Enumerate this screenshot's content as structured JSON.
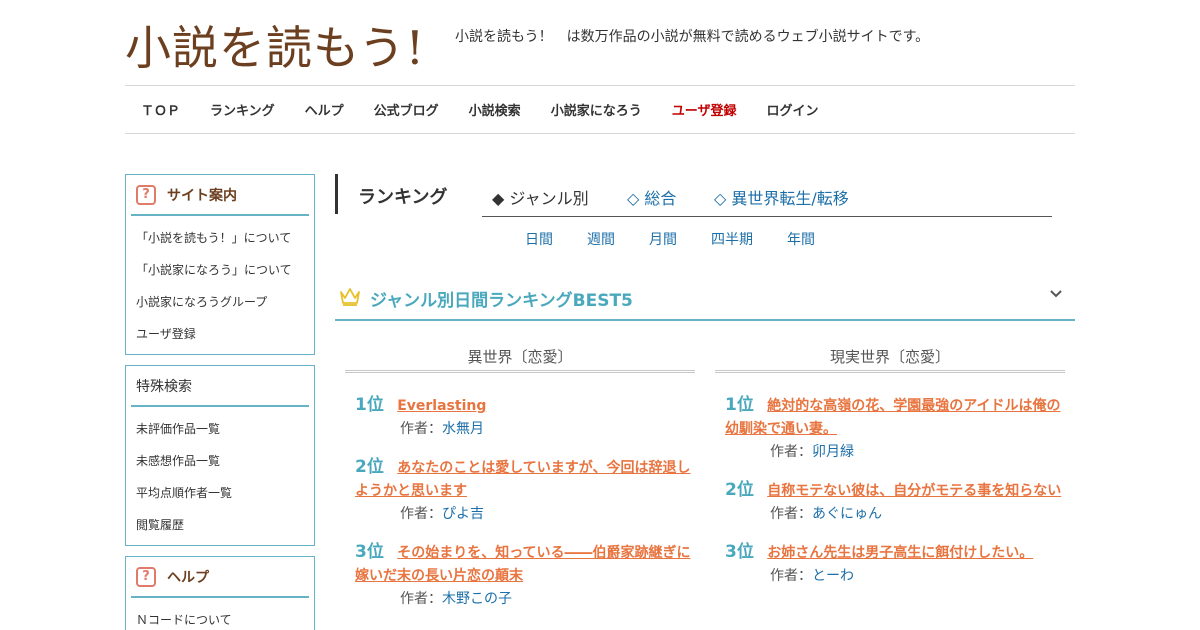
{
  "header": {
    "logo": "小説を読もう!",
    "tagline": "小説を読もう！　は数万作品の小説が無料で読めるウェブ小説サイトです。"
  },
  "nav": {
    "items": [
      "ＴＯＰ",
      "ランキング",
      "ヘルプ",
      "公式ブログ",
      "小説検索",
      "小説家になろう",
      "ユーザ登録",
      "ログイン"
    ]
  },
  "sidebar": {
    "site_guide": {
      "title": "サイト案内",
      "items": [
        "「小説を読もう！」について",
        "「小説家になろう」について",
        "小説家になろうグループ",
        "ユーザ登録"
      ]
    },
    "special_search": {
      "title": "特殊検索",
      "items": [
        "未評価作品一覧",
        "未感想作品一覧",
        "平均点順作者一覧",
        "閲覧履歴"
      ]
    },
    "help": {
      "title": "ヘルプ",
      "items": [
        "Ｎコードについて"
      ]
    }
  },
  "ranking": {
    "title": "ランキング",
    "tabs": [
      "◆ ジャンル別",
      "◇ 総合",
      "◇ 異世界転生/転移"
    ],
    "periods": [
      "日間",
      "週間",
      "月間",
      "四半期",
      "年間"
    ],
    "section_title": "ジャンル別日間ランキングBEST5",
    "author_label": "作者：",
    "columns": [
      {
        "genre": "異世界〔恋愛〕",
        "entries": [
          {
            "rank": "1位",
            "title": "Everlasting",
            "author": "水無月"
          },
          {
            "rank": "2位",
            "title": "あなたのことは愛していますが、今回は辞退しようかと思います",
            "author": "ぴよ吉"
          },
          {
            "rank": "3位",
            "title": "その始まりを、知っている――伯爵家跡継ぎに嫁いだ末の長い片恋の顛末",
            "author": "木野この子"
          }
        ]
      },
      {
        "genre": "現実世界〔恋愛〕",
        "entries": [
          {
            "rank": "1位",
            "title": "絶対的な高嶺の花、学園最強のアイドルは俺の幼馴染で通い妻。",
            "author": "卯月緑"
          },
          {
            "rank": "2位",
            "title": "自称モテない彼は、自分がモテる事を知らない",
            "author": "あぐにゅん"
          },
          {
            "rank": "3位",
            "title": "お姉さん先生は男子高生に餌付けしたい。",
            "author": "とーわ"
          }
        ]
      }
    ]
  },
  "colors": {
    "accent": "#67b2c4",
    "title_link": "#e8743f",
    "logo": "#6b3f1f",
    "register": "#c00000"
  }
}
